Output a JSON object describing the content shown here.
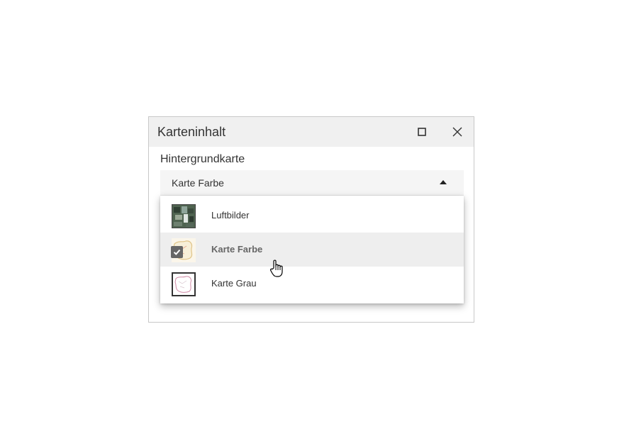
{
  "panel": {
    "title": "Karteninhalt",
    "maximize_icon": "square-icon",
    "close_icon": "close-icon"
  },
  "basemap": {
    "label": "Hintergrundkarte",
    "selected_value": "Karte Farbe",
    "options": [
      {
        "label": "Luftbilder",
        "icon": "aerial-thumbnail",
        "selected": false
      },
      {
        "label": "Karte Farbe",
        "icon": "color-map-thumbnail",
        "selected": true
      },
      {
        "label": "Karte Grau",
        "icon": "gray-map-thumbnail",
        "selected": false
      }
    ]
  },
  "colors": {
    "header_bg": "#f0f0f0",
    "selected_row_bg": "#eeeeee",
    "check_badge": "#666666"
  }
}
